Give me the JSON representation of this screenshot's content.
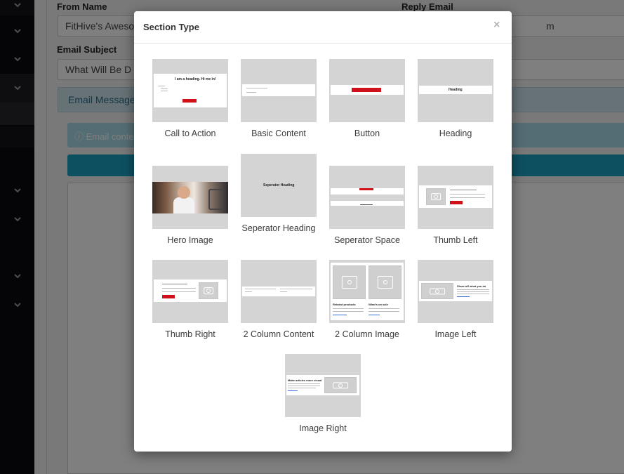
{
  "background": {
    "from_name_label": "From Name",
    "from_name_value": "FitHive's Awesome",
    "reply_email_label": "Reply Email",
    "reply_email_value": "m",
    "email_subject_label": "Email Subject",
    "email_subject_value": "What Will Be D",
    "email_message_tab": "Email Message",
    "info_text": "Email conte"
  },
  "modal": {
    "title": "Section Type",
    "close": "×",
    "tiles": [
      {
        "label": "Call to Action"
      },
      {
        "label": "Basic Content"
      },
      {
        "label": "Button"
      },
      {
        "label": "Heading"
      },
      {
        "label": "Hero Image"
      },
      {
        "label": "Seperator Heading"
      },
      {
        "label": "Seperator Space"
      },
      {
        "label": "Thumb Left"
      },
      {
        "label": "Thumb Right"
      },
      {
        "label": "2 Column Content"
      },
      {
        "label": "2 Column Image"
      },
      {
        "label": "Image Left"
      },
      {
        "label": "Image Right"
      }
    ],
    "thumb_text": {
      "cta_heading": "I am a heading. Hi me in!",
      "heading_text": "Heading",
      "separator_heading_text": "Seperator Heading",
      "two_col_left": "Related products",
      "two_col_right": "What's on sale",
      "image_left_heading": "Show off what you do",
      "image_right_heading": "Make articles more visual"
    }
  },
  "colors": {
    "accent_red": "#d0111b",
    "info_blue": "#1aa3c2"
  }
}
